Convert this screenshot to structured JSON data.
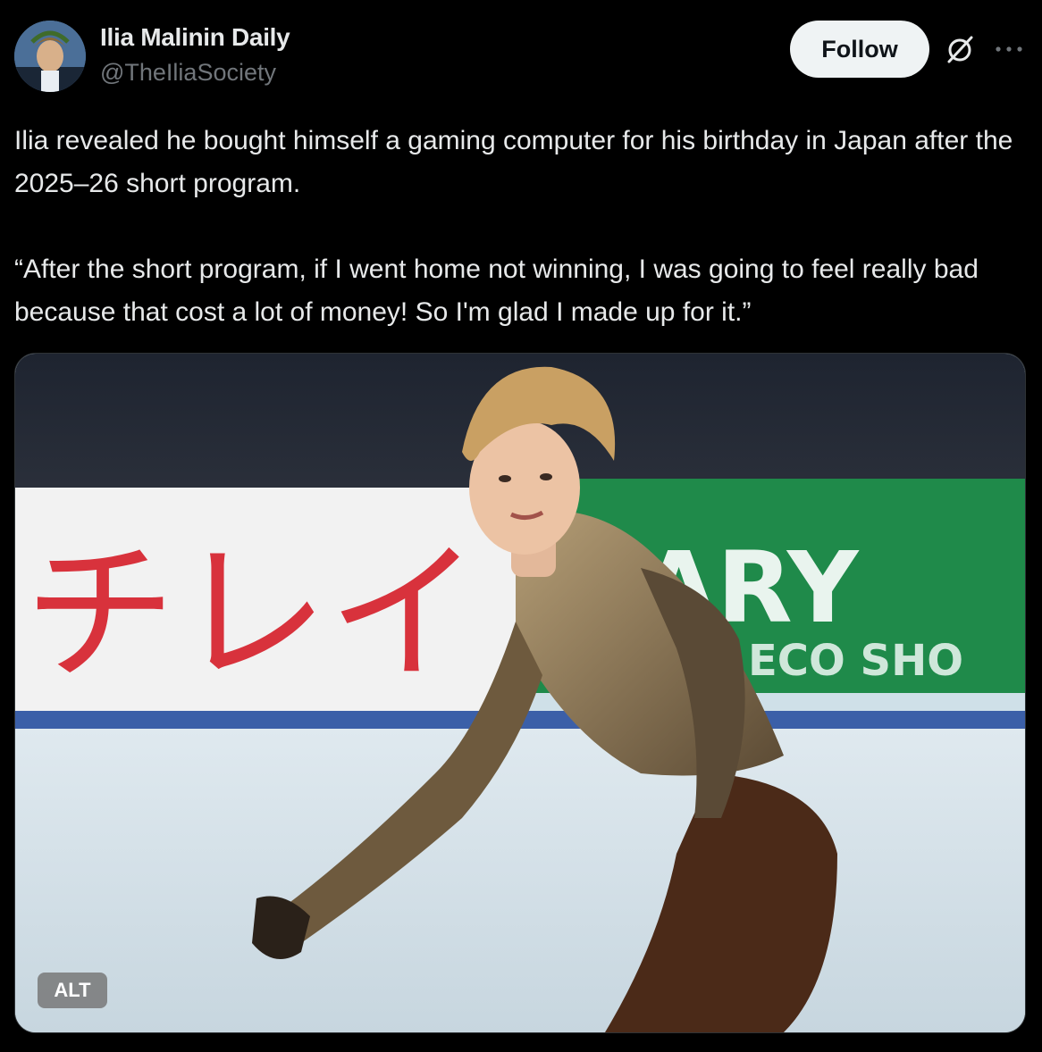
{
  "author": {
    "display_name": "Ilia Malinin Daily",
    "handle": "@TheIliaSociety"
  },
  "actions": {
    "follow_label": "Follow",
    "grok_icon": "grok-icon",
    "more_icon": "more-icon"
  },
  "tweet": {
    "paragraph_1": "Ilia revealed he bought himself a gaming computer for his birthday in Japan after the 2025–26 short program.",
    "paragraph_2": "“After the short program, if I went home not winning, I was going to feel really bad because that cost a lot of money! So I'm glad I made up for it.”"
  },
  "media": {
    "alt_label": "ALT",
    "banner_left_text": "チレイ",
    "banner_right_text": "ARY",
    "banner_right_subtext": "ECO SHO"
  },
  "colors": {
    "background": "#000000",
    "text_primary": "#e7e9ea",
    "text_secondary": "#71767b",
    "follow_bg": "#eff3f4"
  }
}
